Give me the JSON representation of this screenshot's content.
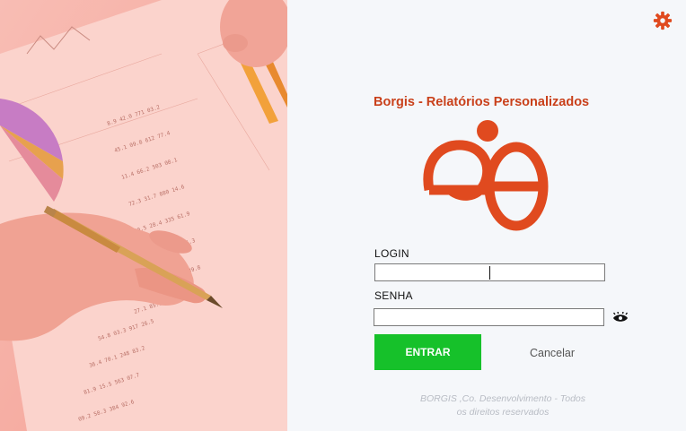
{
  "brand": {
    "title": "Borgis - Relatórios Personalizados",
    "accent_color": "#e04a1f",
    "logo_icon": "borgis-logo"
  },
  "settings": {
    "icon": "gear-icon"
  },
  "form": {
    "login_label": "LOGIN",
    "login_value": "",
    "senha_label": "SENHA",
    "senha_value": "",
    "show_password_icon": "eye-icon"
  },
  "actions": {
    "enter_label": "ENTRAR",
    "enter_color": "#16c12a",
    "cancel_label": "Cancelar"
  },
  "footer": {
    "line1": "BORGIS ,Co. Desenvolvimento - Todos",
    "line2": "os direitos reservados"
  },
  "background_image": {
    "subject": "hand-writing-on-financial-report"
  }
}
